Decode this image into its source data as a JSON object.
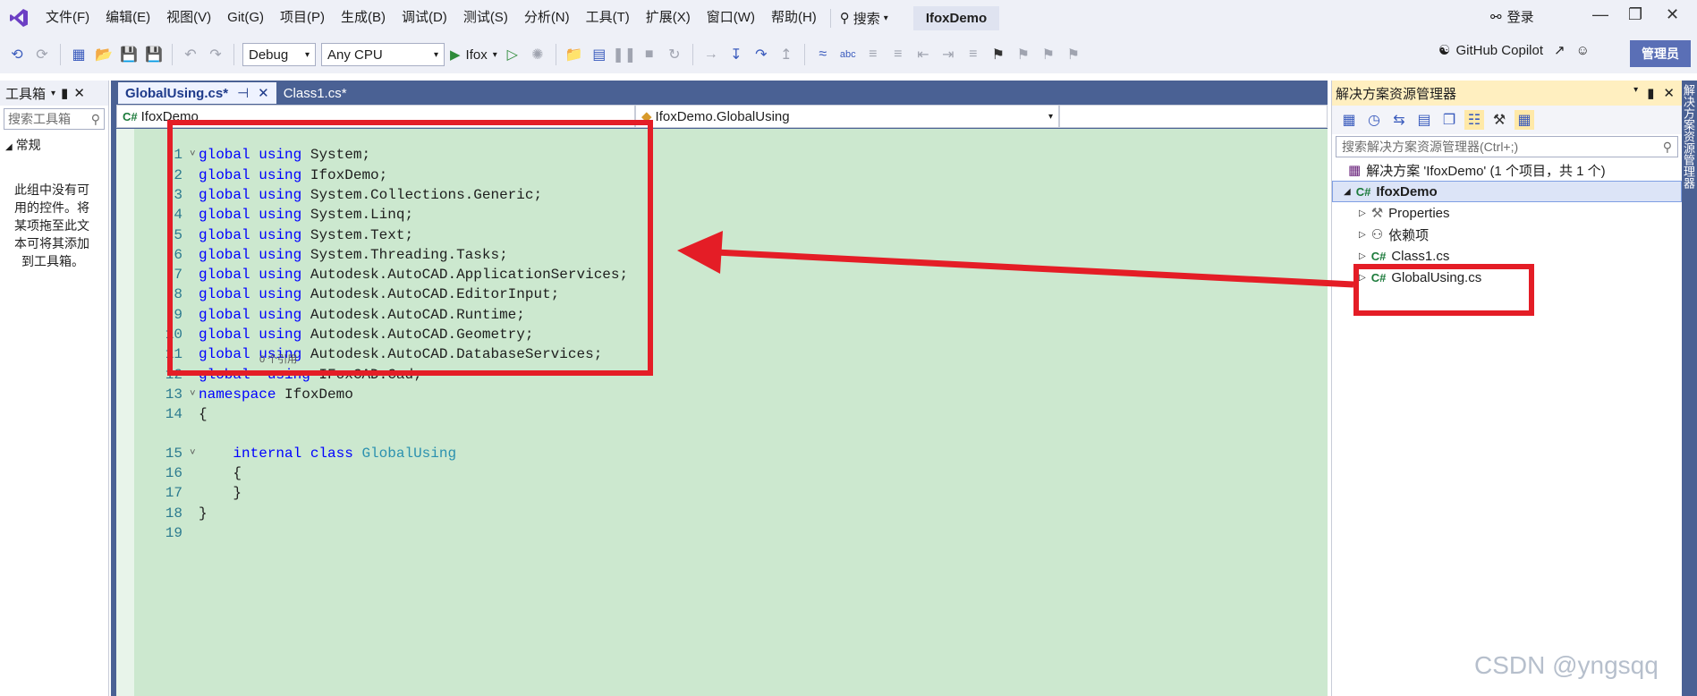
{
  "menubar": {
    "items": [
      "文件(F)",
      "编辑(E)",
      "视图(V)",
      "Git(G)",
      "项目(P)",
      "生成(B)",
      "调试(D)",
      "测试(S)",
      "分析(N)",
      "工具(T)",
      "扩展(X)",
      "窗口(W)",
      "帮助(H)"
    ],
    "search_label": "搜索",
    "project_name": "IfoxDemo",
    "login_label": "登录"
  },
  "toolbar": {
    "config": "Debug",
    "platform": "Any CPU",
    "run_target": "Ifox",
    "copilot_label": "GitHub Copilot",
    "admin_label": "管理员"
  },
  "toolbox": {
    "title": "工具箱",
    "search_placeholder": "搜索工具箱",
    "group": "常规",
    "empty_lines": [
      "此组中没有可",
      "用的控件。将",
      "某项拖至此文",
      "本可将其添加",
      "到工具箱。"
    ]
  },
  "editor": {
    "tabs": [
      {
        "label": "GlobalUsing.cs*",
        "active": true
      },
      {
        "label": "Class1.cs*",
        "active": false
      }
    ],
    "nav_project": "IfoxDemo",
    "nav_class": "IfoxDemo.GlobalUsing",
    "codelens": "0 个引用",
    "lines": [
      {
        "n": "1",
        "tokens": [
          [
            "kw",
            "global"
          ],
          [
            "id",
            " "
          ],
          [
            "kw",
            "using"
          ],
          [
            "id",
            " System;"
          ]
        ]
      },
      {
        "n": "2",
        "tokens": [
          [
            "kw",
            "global"
          ],
          [
            "id",
            " "
          ],
          [
            "kw",
            "using"
          ],
          [
            "id",
            " IfoxDemo;"
          ]
        ]
      },
      {
        "n": "3",
        "tokens": [
          [
            "kw",
            "global"
          ],
          [
            "id",
            " "
          ],
          [
            "kw",
            "using"
          ],
          [
            "id",
            " System.Collections.Generic;"
          ]
        ]
      },
      {
        "n": "4",
        "tokens": [
          [
            "kw",
            "global"
          ],
          [
            "id",
            " "
          ],
          [
            "kw",
            "using"
          ],
          [
            "id",
            " System.Linq;"
          ]
        ]
      },
      {
        "n": "5",
        "tokens": [
          [
            "kw",
            "global"
          ],
          [
            "id",
            " "
          ],
          [
            "kw",
            "using"
          ],
          [
            "id",
            " System.Text;"
          ]
        ]
      },
      {
        "n": "6",
        "tokens": [
          [
            "kw",
            "global"
          ],
          [
            "id",
            " "
          ],
          [
            "kw",
            "using"
          ],
          [
            "id",
            " System.Threading.Tasks;"
          ]
        ]
      },
      {
        "n": "7",
        "tokens": [
          [
            "kw",
            "global"
          ],
          [
            "id",
            " "
          ],
          [
            "kw",
            "using"
          ],
          [
            "id",
            " Autodesk.AutoCAD.ApplicationServices;"
          ]
        ]
      },
      {
        "n": "8",
        "tokens": [
          [
            "kw",
            "global"
          ],
          [
            "id",
            " "
          ],
          [
            "kw",
            "using"
          ],
          [
            "id",
            " Autodesk.AutoCAD.EditorInput;"
          ]
        ]
      },
      {
        "n": "9",
        "tokens": [
          [
            "kw",
            "global"
          ],
          [
            "id",
            " "
          ],
          [
            "kw",
            "using"
          ],
          [
            "id",
            " Autodesk.AutoCAD.Runtime;"
          ]
        ]
      },
      {
        "n": "10",
        "tokens": [
          [
            "kw",
            "global"
          ],
          [
            "id",
            " "
          ],
          [
            "kw",
            "using"
          ],
          [
            "id",
            " Autodesk.AutoCAD.Geometry;"
          ]
        ]
      },
      {
        "n": "11",
        "tokens": [
          [
            "kw",
            "global"
          ],
          [
            "id",
            " "
          ],
          [
            "kw",
            "using"
          ],
          [
            "id",
            " Autodesk.AutoCAD.DatabaseServices;"
          ]
        ]
      },
      {
        "n": "12",
        "tokens": [
          [
            "kw",
            "global"
          ],
          [
            "id",
            "  "
          ],
          [
            "kw",
            "using"
          ],
          [
            "id",
            " IFoxCAD.Cad;"
          ]
        ]
      },
      {
        "n": "13",
        "tokens": [
          [
            "kw",
            "namespace"
          ],
          [
            "id",
            " IfoxDemo"
          ]
        ]
      },
      {
        "n": "14",
        "tokens": [
          [
            "id",
            "{"
          ]
        ]
      },
      {
        "n": "15",
        "tokens": [
          [
            "id",
            "    "
          ],
          [
            "kw",
            "internal"
          ],
          [
            "id",
            " "
          ],
          [
            "kw",
            "class"
          ],
          [
            "id",
            " "
          ],
          [
            "ty",
            "GlobalUsing"
          ]
        ]
      },
      {
        "n": "16",
        "tokens": [
          [
            "id",
            "    {"
          ]
        ]
      },
      {
        "n": "17",
        "tokens": [
          [
            "id",
            "    }"
          ]
        ]
      },
      {
        "n": "18",
        "tokens": [
          [
            "id",
            "}"
          ]
        ]
      },
      {
        "n": "19",
        "tokens": []
      }
    ]
  },
  "solution_explorer": {
    "title": "解决方案资源管理器",
    "search_placeholder": "搜索解决方案资源管理器(Ctrl+;)",
    "solution_label": "解决方案 'IfoxDemo' (1 个项目，共 1 个)",
    "project_label": "IfoxDemo",
    "items": [
      {
        "label": "Properties",
        "icon": "properties-icon"
      },
      {
        "label": "依赖项",
        "icon": "dependencies-icon"
      },
      {
        "label": "Class1.cs",
        "icon": "csharp-file-icon"
      },
      {
        "label": "GlobalUsing.cs",
        "icon": "csharp-file-icon"
      }
    ],
    "side_tab_label": "解决方案资源管理器"
  },
  "watermark": "CSDN @yngsqq",
  "colors": {
    "annotation_red": "#e41d26",
    "code_background": "#cce8cf",
    "keyword_blue": "#0000ff",
    "type_teal": "#2b91af"
  }
}
